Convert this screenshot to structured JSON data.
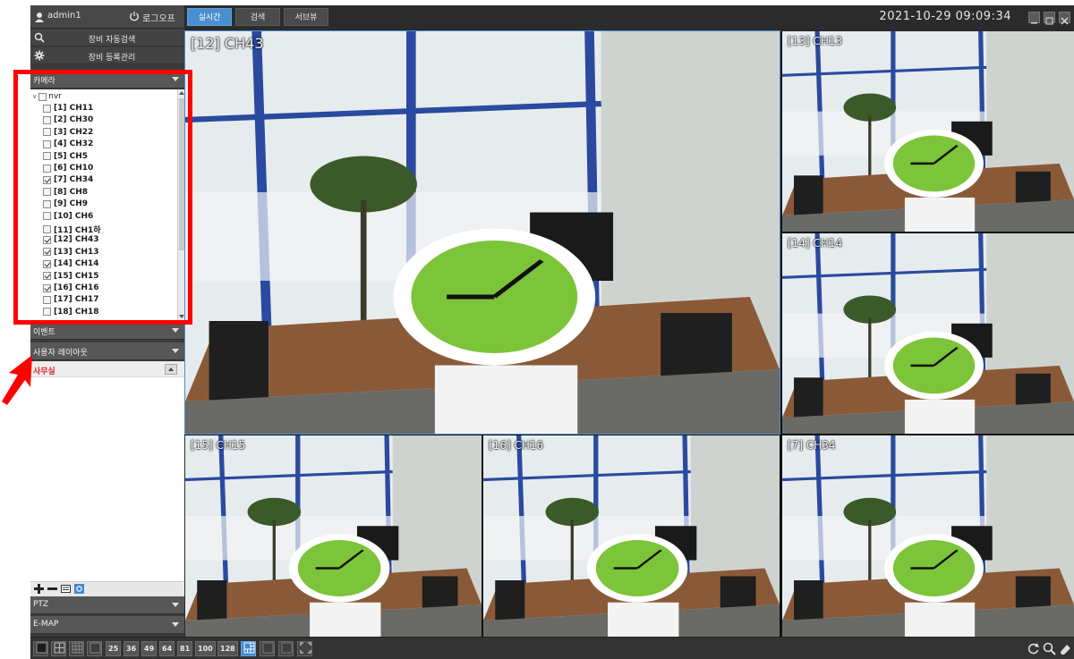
{
  "header": {
    "user": "admin1",
    "logout": "로그오프",
    "datetime": "2021-10-29 09:09:34"
  },
  "sidebar": {
    "menu": [
      {
        "label": "장비 자동검색",
        "icon": "search-icon"
      },
      {
        "label": "장비 등록관리",
        "icon": "gear-icon"
      }
    ],
    "camera_section": "카메라",
    "tree_root": "nvr",
    "channels": [
      {
        "label": "[1] CH11",
        "checked": false
      },
      {
        "label": "[2] CH30",
        "checked": false
      },
      {
        "label": "[3] CH22",
        "checked": false
      },
      {
        "label": "[4] CH32",
        "checked": false
      },
      {
        "label": "[5] CH5",
        "checked": false
      },
      {
        "label": "[6] CH10",
        "checked": false
      },
      {
        "label": "[7] CH34",
        "checked": true
      },
      {
        "label": "[8] CH8",
        "checked": false
      },
      {
        "label": "[9] CH9",
        "checked": false
      },
      {
        "label": "[10] CH6",
        "checked": false
      },
      {
        "label": "[11] CH1하",
        "checked": false
      },
      {
        "label": "[12] CH43",
        "checked": true
      },
      {
        "label": "[13] CH13",
        "checked": true
      },
      {
        "label": "[14] CH14",
        "checked": true
      },
      {
        "label": "[15] CH15",
        "checked": true
      },
      {
        "label": "[16] CH16",
        "checked": true
      },
      {
        "label": "[17] CH17",
        "checked": false
      },
      {
        "label": "[18] CH18",
        "checked": false
      }
    ],
    "event_section": "이벤트",
    "user_layout_section": "사용자 레이아웃",
    "layout_item": "사무실",
    "ptz_section": "PTZ",
    "emap_section": "E-MAP"
  },
  "tabs": [
    "실시간",
    "검색",
    "서브뷰"
  ],
  "active_tab": "실시간",
  "cameras": [
    {
      "label": "[12] CH43"
    },
    {
      "label": "[13] CH13"
    },
    {
      "label": "[14] CH14"
    },
    {
      "label": "[15] CH15"
    },
    {
      "label": "[16] CH16"
    },
    {
      "label": "[7] CH34"
    }
  ],
  "layout_buttons": [
    "25",
    "36",
    "49",
    "64",
    "81",
    "100",
    "128"
  ],
  "colors": {
    "accent": "#4a8fcf",
    "annotation": "#ff0000",
    "active_layout_text": "#e0242a"
  }
}
